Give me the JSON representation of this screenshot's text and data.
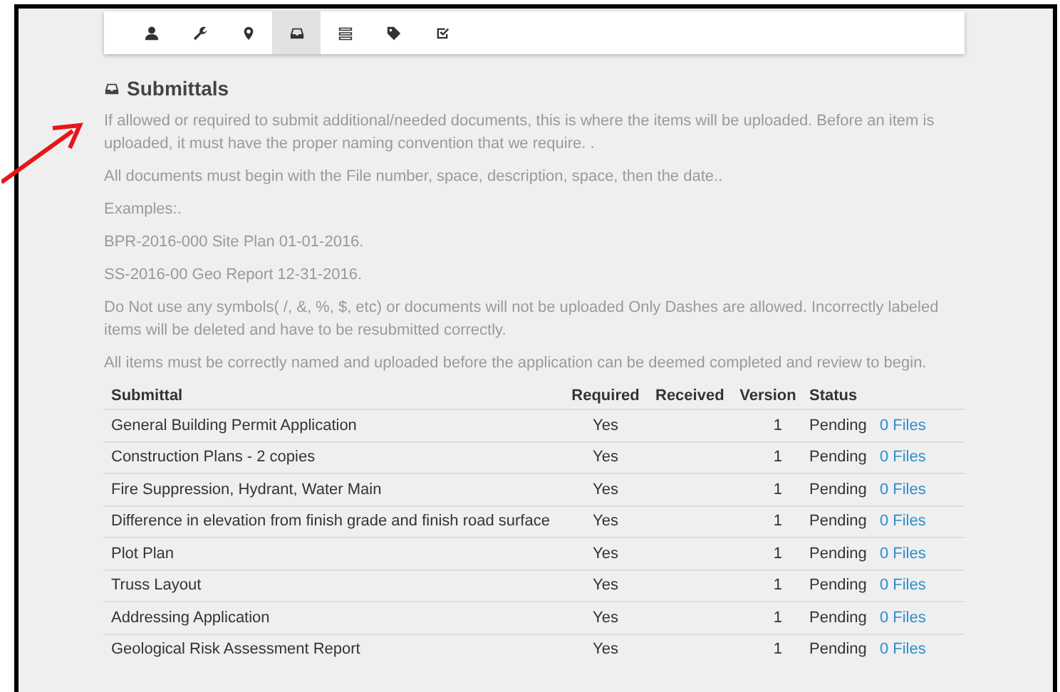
{
  "tabs": [
    {
      "kind": "user",
      "selected": false
    },
    {
      "kind": "wrench",
      "selected": false
    },
    {
      "kind": "pin",
      "selected": false
    },
    {
      "kind": "inbox",
      "selected": true
    },
    {
      "kind": "list",
      "selected": false
    },
    {
      "kind": "tag",
      "selected": false
    },
    {
      "kind": "check",
      "selected": false
    }
  ],
  "heading": "Submittals",
  "paragraphs": [
    "If allowed or required to submit additional/needed documents, this is where the items will be uploaded. Before an item is uploaded, it must have the proper naming convention that we require. .",
    "All documents must begin with the File number, space, description, space, then the date..",
    "Examples:.",
    "BPR-2016-000 Site Plan 01-01-2016.",
    "SS-2016-00 Geo Report 12-31-2016.",
    "Do Not use any symbols( /, &, %, $, etc) or documents will not be uploaded Only Dashes are allowed. Incorrectly labeled items will be deleted and have to be resubmitted correctly.",
    "All items must be correctly named and uploaded before the application can be deemed completed and review to begin."
  ],
  "table": {
    "columns": [
      "Submittal",
      "Required",
      "Received",
      "Version",
      "Status"
    ],
    "rows": [
      {
        "submittal": "General Building Permit Application",
        "required": "Yes",
        "version": "1",
        "status": "Pending",
        "files": "0 Files"
      },
      {
        "submittal": "Construction Plans - 2 copies",
        "required": "Yes",
        "version": "1",
        "status": "Pending",
        "files": "0 Files"
      },
      {
        "submittal": "Fire Suppression, Hydrant, Water Main",
        "required": "Yes",
        "version": "1",
        "status": "Pending",
        "files": "0 Files"
      },
      {
        "submittal": "Difference in elevation from finish grade and finish road surface",
        "required": "Yes",
        "version": "1",
        "status": "Pending",
        "files": "0 Files"
      },
      {
        "submittal": "Plot Plan",
        "required": "Yes",
        "version": "1",
        "status": "Pending",
        "files": "0 Files"
      },
      {
        "submittal": "Truss Layout",
        "required": "Yes",
        "version": "1",
        "status": "Pending",
        "files": "0 Files"
      },
      {
        "submittal": "Addressing Application",
        "required": "Yes",
        "version": "1",
        "status": "Pending",
        "files": "0 Files"
      },
      {
        "submittal": "Geological Risk Assessment Report",
        "required": "Yes",
        "version": "1",
        "status": "Pending",
        "files": "0 Files"
      }
    ]
  }
}
